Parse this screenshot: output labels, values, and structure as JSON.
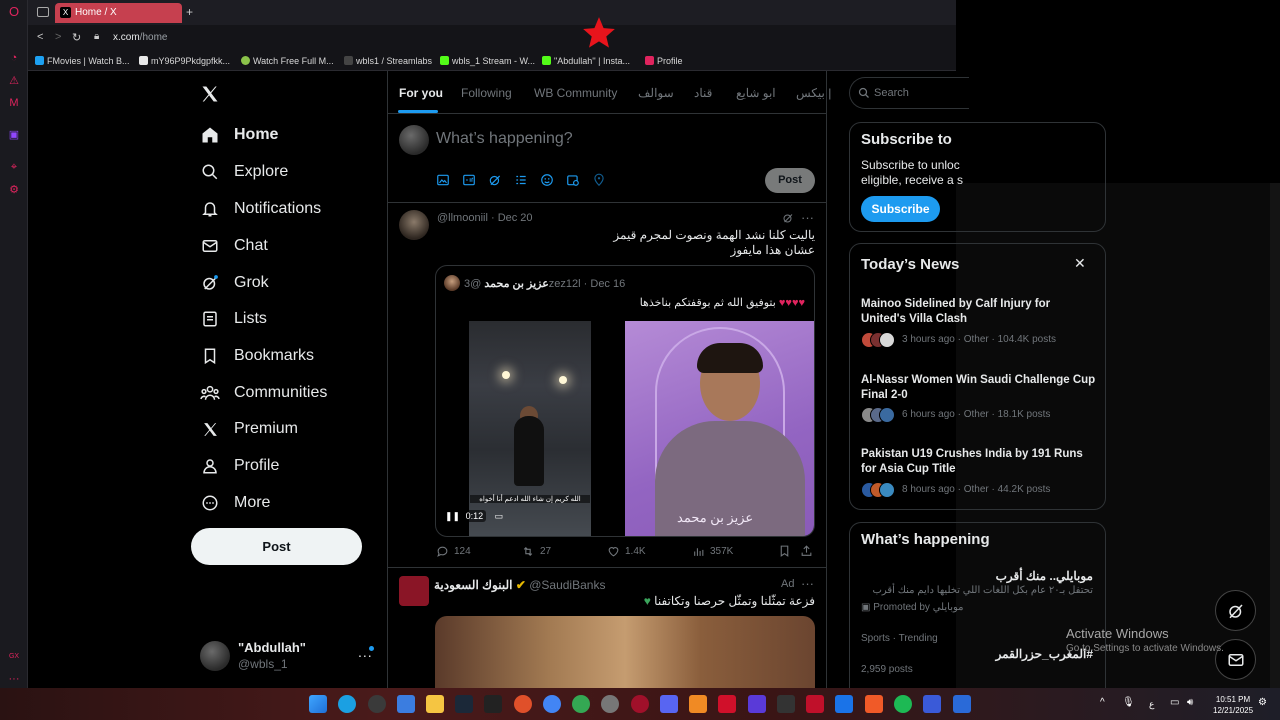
{
  "browser": {
    "tab_title": "Home / X",
    "url_host": "x.com",
    "url_path": "/home",
    "bookmarks": [
      {
        "label": "FMovies | Watch B...",
        "color": "#1da1f2"
      },
      {
        "label": "mY96P9Pkdgpfkk...",
        "color": "#e8e8e8"
      },
      {
        "label": "Watch Free Full M...",
        "color": "#8bc34a"
      },
      {
        "label": "wbls1 / Streamlabs",
        "color": "#444444"
      },
      {
        "label": "wbls_1 Stream - W...",
        "color": "#53fc18"
      },
      {
        "label": "\"Abdullah'' | Insta...",
        "color": "#53fc18"
      },
      {
        "label": "Profile",
        "color": "#e0245e"
      }
    ],
    "opera_side_label": "GX"
  },
  "nav": {
    "items": [
      {
        "label": "Home",
        "icon": "home-icon"
      },
      {
        "label": "Explore",
        "icon": "search-icon"
      },
      {
        "label": "Notifications",
        "icon": "bell-icon"
      },
      {
        "label": "Chat",
        "icon": "envelope-icon"
      },
      {
        "label": "Grok",
        "icon": "grok-icon"
      },
      {
        "label": "Lists",
        "icon": "list-icon"
      },
      {
        "label": "Bookmarks",
        "icon": "bookmark-icon"
      },
      {
        "label": "Communities",
        "icon": "people-icon"
      },
      {
        "label": "Premium",
        "icon": "x-logo-icon"
      },
      {
        "label": "Profile",
        "icon": "person-icon"
      },
      {
        "label": "More",
        "icon": "more-circle-icon"
      }
    ],
    "post_label": "Post",
    "user": {
      "name": "\"Abdullah\"",
      "handle": "@wbls_1",
      "more": "..."
    }
  },
  "timeline": {
    "tabs": [
      "For you",
      "Following",
      "WB Community",
      "سوالف",
      "قناد",
      "ابو شايع",
      "بيكس |"
    ],
    "compose_placeholder": "What’s happening?",
    "compose_post_label": "Post",
    "tweet1": {
      "handle": "@llmooniil",
      "date": "· Dec 20",
      "line1": "ياليت كلنا نشد الهمة ونصوت لمجرم قيمز",
      "line2": "عشان هذا مايفوز",
      "quote": {
        "name": "عزيز بن محمد",
        "handle": "@3zez12l",
        "date": "· Dec 16",
        "text": "بتوفيق الله ثم بوقفتكم بناخذها",
        "hearts": "♥♥♥♥",
        "video_time": "0:12",
        "photo1_caption": "الله كريم إن شاء الله ادعم أنا أخواه",
        "photo2_caption": "عزيز بن محمد"
      },
      "actions": {
        "replies": "124",
        "reposts": "27",
        "likes": "1.4K",
        "views": "357K"
      }
    },
    "tweet2": {
      "name": "البنوك السعودية",
      "handle": "@SaudiBanks",
      "ad_label": "Ad",
      "text": "فزعة تمثّلنا وتمثّل حرصنا وتكاتفنا"
    }
  },
  "sidebar": {
    "search_placeholder": "Search",
    "subscribe": {
      "title": "Subscribe to",
      "line1": "Subscribe to unloc",
      "line2": "eligible, receive a s",
      "button": "Subscribe"
    },
    "news": {
      "title": "Today’s News",
      "items": [
        {
          "title": "Mainoo Sidelined by Calf Injury for United's Villa Clash",
          "meta": "3 hours ago · Other · 104.4K posts"
        },
        {
          "title": "Al-Nassr Women Win Saudi Challenge Cup Final 2-0",
          "meta": "6 hours ago · Other · 18.1K posts"
        },
        {
          "title": "Pakistan U19 Crushes India by 191 Runs for Asia Cup Title",
          "meta": "8 hours ago · Other · 44.2K posts"
        }
      ]
    },
    "happening": {
      "title": "What’s happening",
      "promo_title": "موبايلي.. منك أقرب",
      "promo_text": "تحتفل بـ٢٠ عام بكل اللغات اللي تخليها دايم منك أقرب",
      "promoted_by": "Promoted by موبايلي",
      "trend_category": "Sports · Trending",
      "trend_name": "#المغرب_حزرالقمر",
      "trend_posts": "2,959 posts"
    }
  },
  "windows": {
    "activate_title": "Activate Windows",
    "activate_sub": "Go to Settings to activate Windows.",
    "clock_time": "10:51 PM",
    "clock_date": "12/21/2025",
    "lang": "ع"
  },
  "colors": {
    "accent": "#1d9bf0",
    "background": "#000000",
    "border": "#2f3336",
    "tab_active": "#c6404f"
  }
}
